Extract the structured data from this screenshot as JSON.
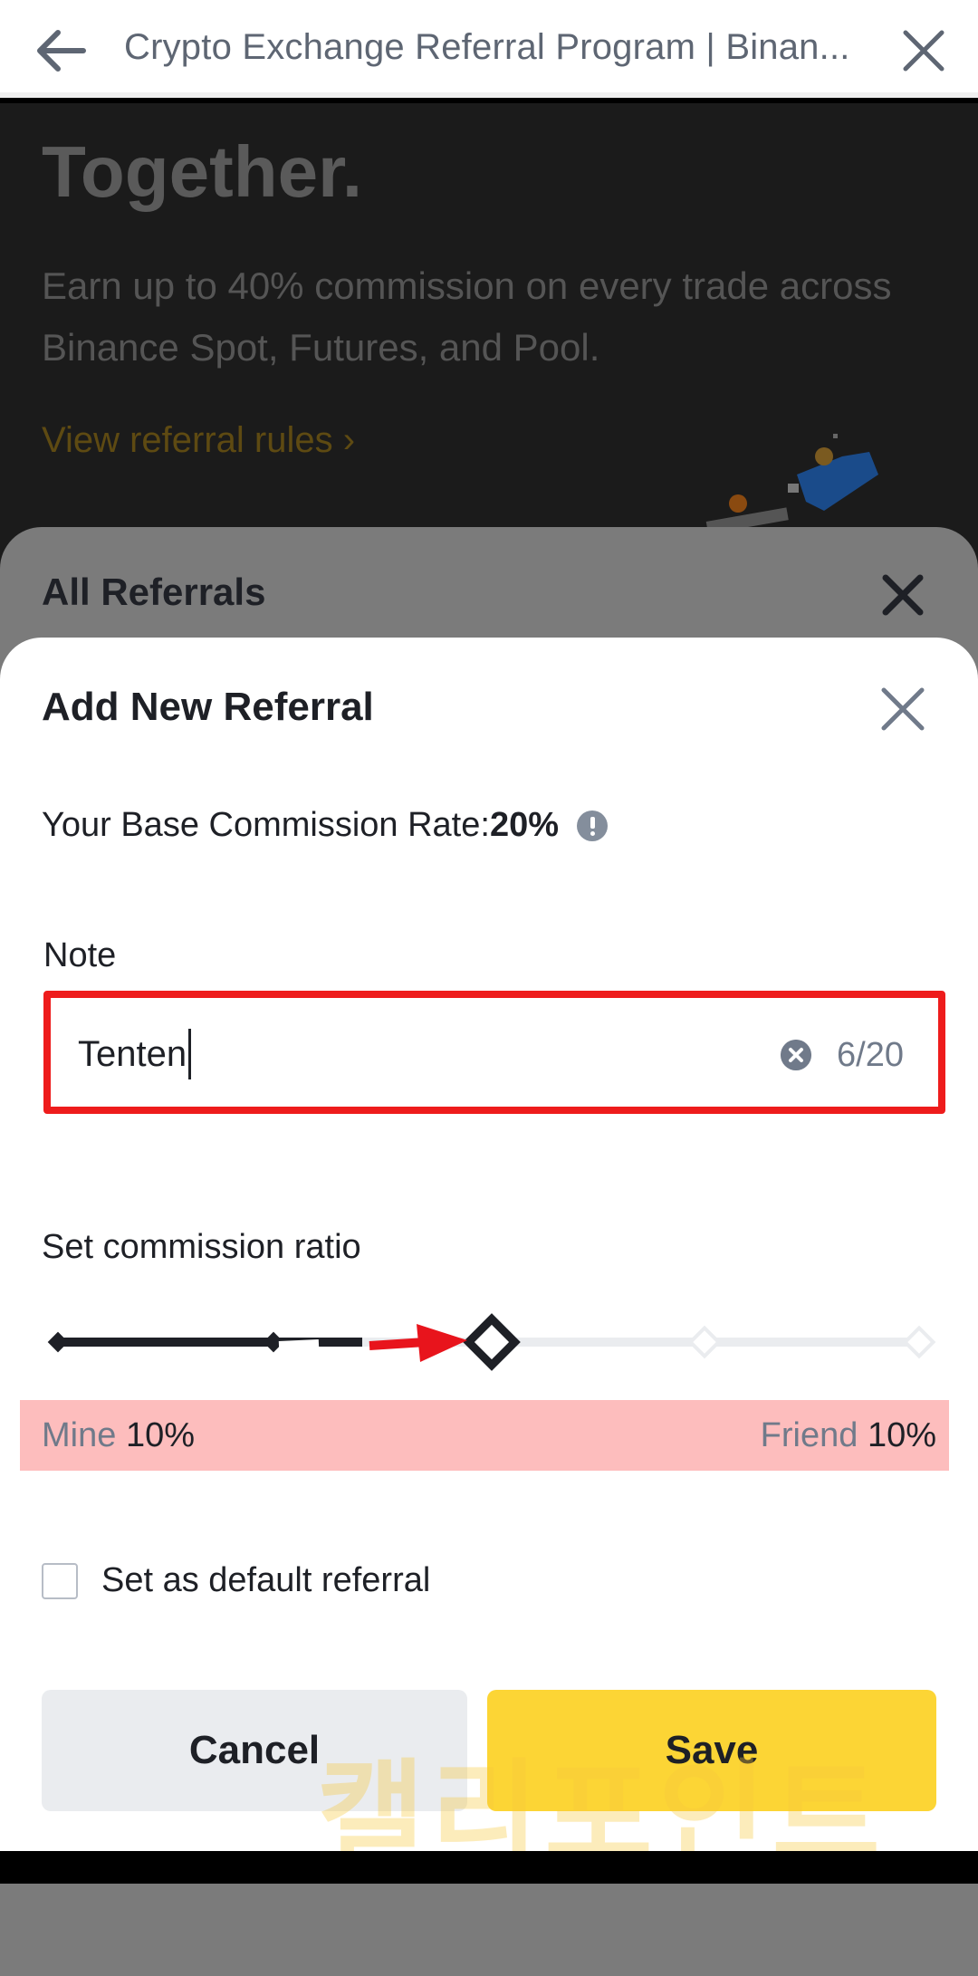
{
  "browser": {
    "title": "Crypto Exchange Referral Program | Binan..."
  },
  "background_page": {
    "headline": "Together.",
    "description": "Earn up to 40% commission on every trade across Binance Spot, Futures, and Pool.",
    "rules_link": "View referral rules ›"
  },
  "all_referrals_sheet": {
    "title": "All Referrals"
  },
  "add_referral_sheet": {
    "title": "Add New Referral",
    "base_rate_label": "Your Base Commission Rate:",
    "base_rate_value": "20%",
    "note_label": "Note",
    "note_value": "Tenten",
    "note_counter": "6/20",
    "ratio_label": "Set commission ratio",
    "ratio_steps": 5,
    "ratio_selected_index": 2,
    "mine_label": "Mine",
    "mine_value": "10%",
    "friend_label": "Friend",
    "friend_value": "10%",
    "default_label": "Set as default referral",
    "default_checked": false,
    "cancel_label": "Cancel",
    "save_label": "Save"
  },
  "watermark_text": "캘리포인트",
  "colors": {
    "accent": "#fcd535",
    "highlight_border": "#ee1c1c",
    "highlight_fill": "#fdbdbd",
    "text_primary": "#1e2026",
    "text_secondary": "#707a8a"
  }
}
